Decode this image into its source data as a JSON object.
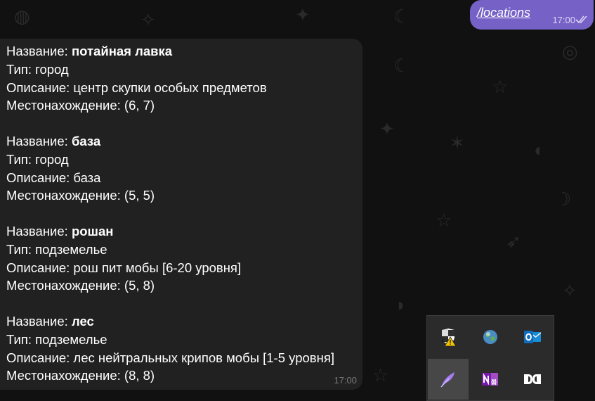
{
  "outgoing": {
    "text": "/locations",
    "time": "17:00",
    "status_icon": "double-check-icon"
  },
  "incoming": {
    "time": "17:00",
    "locations": [
      {
        "name_label": "Название: ",
        "name": "потайная лавка",
        "type_line": "Тип: город",
        "desc_line": "Описание: центр скупки особых предметов",
        "pos_line": "Местонахождение: (6, 7)"
      },
      {
        "name_label": "Название: ",
        "name": "база",
        "type_line": "Тип: город",
        "desc_line": "Описание: база",
        "pos_line": "Местонахождение: (5, 5)"
      },
      {
        "name_label": "Название: ",
        "name": "рошан",
        "type_line": "Тип: подземелье",
        "desc_line": "Описание: рош пит мобы [6-20 уровня]",
        "pos_line": "Местонахождение: (5, 8)"
      },
      {
        "name_label": "Название: ",
        "name": "лес",
        "type_line": "Тип: подземелье",
        "desc_line": "Описание: лес нейтральных крипов мобы [1-5 уровня]",
        "pos_line": "Местонахождение: (8, 8)"
      }
    ]
  },
  "tray": {
    "icons": [
      "security-warning-icon",
      "network-globe-icon",
      "outlook-icon",
      "feather-icon",
      "onenote-icon",
      "dolby-icon"
    ]
  },
  "colors": {
    "accent": "#7661c6",
    "bubble": "#212121",
    "background": "#111111"
  }
}
